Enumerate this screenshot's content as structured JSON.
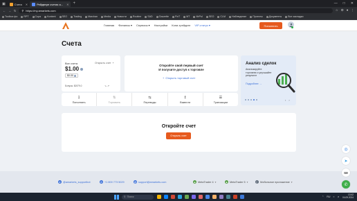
{
  "browser": {
    "tabs": [
      {
        "label": "Счета"
      },
      {
        "label": "Рейдвере счетах a..."
      }
    ],
    "url": "https://my.amarkets.com",
    "bookmarks": [
      "Toolbox фо",
      "RPT",
      "Cupa",
      "Kontent",
      "SEO",
      "Trading",
      "Marchan",
      "Media",
      "Новости",
      "Routine",
      "SAD",
      "Gazzette",
      "FinT",
      "MT",
      "MrPol",
      "SEO",
      "CLM",
      "Наблюдение",
      "Проекты",
      "Документы",
      "Все закладки"
    ]
  },
  "header": {
    "nav": [
      "Главная",
      "Финансы",
      "Сервисы",
      "Настройки",
      "Копи-трейдинг",
      "VIP-статус"
    ],
    "deposit_label": "Пополнить"
  },
  "page": {
    "title": "Счета",
    "balance": {
      "label": "Все счета",
      "open_label": "Открыть счет",
      "amount": "$1.00",
      "pill": "$0.00",
      "bonus": "Бонусы: $1979.0",
      "icons_text": "↘ ↗"
    },
    "open_first": {
      "title": "Откройте свой первый счет",
      "subtitle": "И получите доступ к торговле",
      "link": "Открыть торговый счет"
    },
    "promo": {
      "title": "Анализ сделок",
      "text": "Анализируйте торговлю и улучшайте результат",
      "link": "Подробнее"
    },
    "actions": [
      {
        "label": "Пополнить",
        "icon": "deposit-icon",
        "disabled": false
      },
      {
        "label": "Торговать",
        "icon": "trade-icon",
        "disabled": true
      },
      {
        "label": "Переводы",
        "icon": "transfer-icon",
        "disabled": false
      },
      {
        "label": "Вывести",
        "icon": "withdraw-icon",
        "disabled": false
      },
      {
        "label": "Транзакции",
        "icon": "transactions-icon",
        "disabled": false
      }
    ],
    "open_account": {
      "title": "Откройте счет",
      "button": "Открыть счет"
    }
  },
  "footer": {
    "telegram": "@amarkets_supportbot",
    "phone": "+1 800 773 5029",
    "email": "support@amarkets.com",
    "mt4": "MetaTrader 4",
    "mt5": "MetaTrader 5",
    "mobile": "Мобильное приложение"
  },
  "taskbar": {
    "search_placeholder": "Поиск",
    "time": "13:42",
    "date": "04.09.2024",
    "lang": "RU"
  },
  "colors": {
    "accent": "#e65a1e",
    "link": "#3a6fd8"
  }
}
